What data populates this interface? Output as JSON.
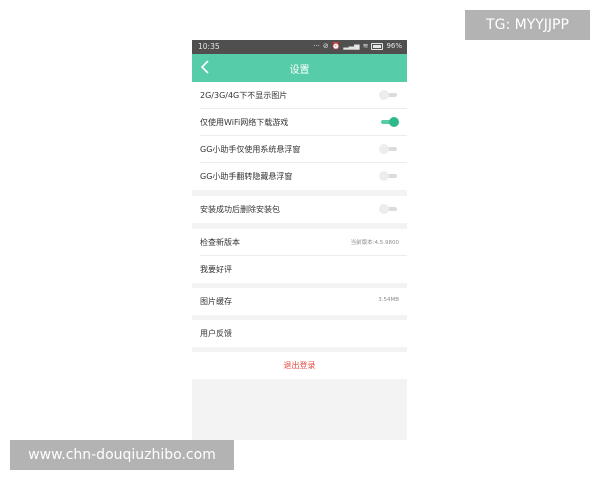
{
  "status_bar": {
    "time": "10:35",
    "battery": "96%"
  },
  "header": {
    "title": "设置"
  },
  "settings": [
    {
      "label": "2G/3G/4G下不显示图片",
      "toggle": "off"
    },
    {
      "label": "仅使用WiFi网络下载游戏",
      "toggle": "on"
    },
    {
      "label": "GG小助手仅使用系统悬浮窗",
      "toggle": "off"
    },
    {
      "label": "GG小助手翻转隐藏悬浮窗",
      "toggle": "off"
    },
    {
      "label": "安装成功后删除安装包",
      "toggle": "off"
    },
    {
      "label": "检查新版本",
      "value": "当前版本:4.5.9800"
    },
    {
      "label": "我要好评"
    },
    {
      "label": "图片缓存",
      "value": "3.54MB"
    },
    {
      "label": "用户反馈"
    }
  ],
  "logout": {
    "label": "退出登录"
  },
  "colors": {
    "accent": "#57cca9",
    "logout_text": "#e44b44"
  },
  "watermarks": {
    "top_right": "TG: MYYJJPP",
    "bottom_left": "www.chn-douqiuzhibo.com"
  }
}
